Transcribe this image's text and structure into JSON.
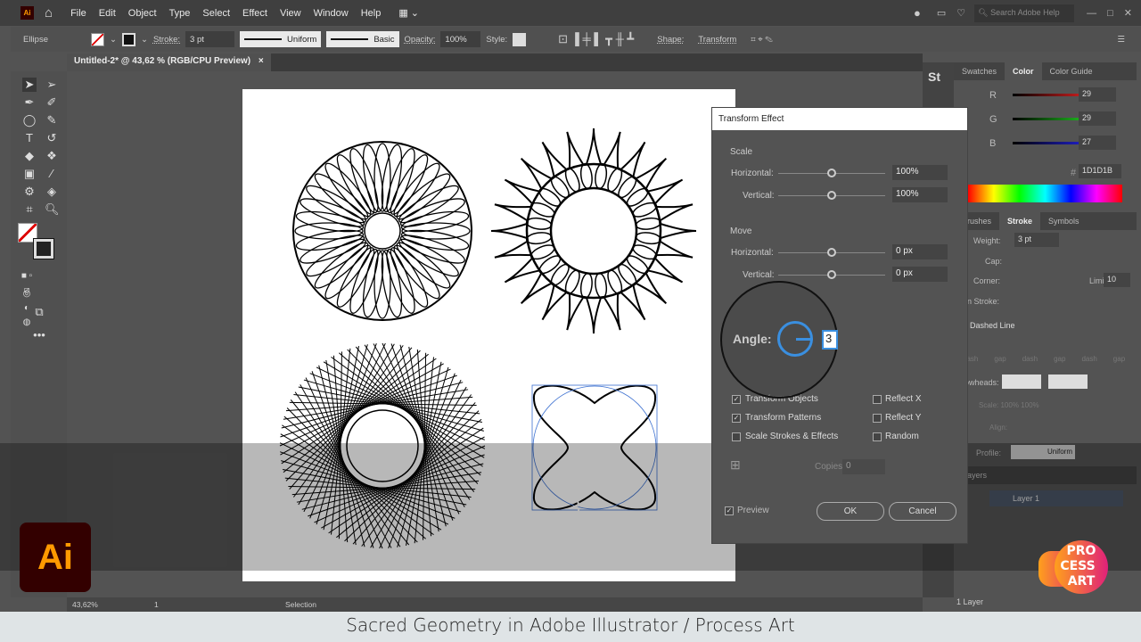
{
  "app": {
    "logo": "Ai",
    "menu": [
      "File",
      "Edit",
      "Object",
      "Type",
      "Select",
      "Effect",
      "View",
      "Window",
      "Help"
    ],
    "search_placeholder": "Search Adobe Help"
  },
  "control": {
    "object": "Ellipse",
    "stroke_label": "Stroke:",
    "stroke_value": "3 pt",
    "profile": "Uniform",
    "brush": "Basic",
    "opacity_label": "Opacity:",
    "opacity_value": "100%",
    "style_label": "Style:",
    "shape_label": "Shape:",
    "transform_label": "Transform"
  },
  "document": {
    "tab": "Untitled-2* @ 43,62 % (RGB/CPU Preview)",
    "close": "×"
  },
  "artwork": {
    "selection_number": "3"
  },
  "dialog": {
    "title": "Transform Effect",
    "scale": {
      "label": "Scale",
      "h_label": "Horizontal:",
      "h_value": "100%",
      "v_label": "Vertical:",
      "v_value": "100%"
    },
    "move": {
      "label": "Move",
      "h_label": "Horizontal:",
      "h_value": "0 px",
      "v_label": "Vertical:",
      "v_value": "0 px"
    },
    "angle": {
      "label": "Angle:",
      "value": "3"
    },
    "options": [
      {
        "label": "Transform Objects",
        "checked": true
      },
      {
        "label": "Transform Patterns",
        "checked": true
      },
      {
        "label": "Scale Strokes & Effects",
        "checked": false
      },
      {
        "label": "Reflect X",
        "checked": false
      },
      {
        "label": "Reflect Y",
        "checked": false
      },
      {
        "label": "Random",
        "checked": false
      }
    ],
    "copies_label": "Copies",
    "copies_value": "0",
    "preview_label": "Preview",
    "ok": "OK",
    "cancel": "Cancel"
  },
  "color_panel": {
    "tabs": [
      "Swatches",
      "Color",
      "Color Guide"
    ],
    "r": "29",
    "g": "29",
    "b": "27",
    "hex_label": "#",
    "hex": "1D1D1B",
    "accent_r": "#d42020",
    "accent_g": "#20c020",
    "accent_b": "#2020d0"
  },
  "stroke_panel": {
    "tabs": [
      "Brushes",
      "Stroke",
      "Symbols"
    ],
    "weight_label": "Weight:",
    "weight": "3 pt",
    "cap_label": "Cap:",
    "corner_label": "Corner:",
    "limit_label": "Limit:",
    "limit": "10",
    "align_label": "Align Stroke:",
    "dashed_label": "Dashed Line",
    "dash_labels": [
      "dash",
      "gap",
      "dash",
      "gap",
      "dash",
      "gap"
    ],
    "arrowheads_label": "Arrowheads:",
    "scale_label": "Scale:",
    "scale1": "100%",
    "scale2": "100%",
    "align2_label": "Align:",
    "profile_label": "Profile:",
    "profile": "Uniform"
  },
  "layers_panel": {
    "tab": "Layers",
    "layer": "Layer 1",
    "count": "1 Layer"
  },
  "status": {
    "zoom": "43,62%",
    "artboard": "1",
    "tool": "Selection"
  },
  "caption": "Sacred Geometry in Adobe Illustrator /  Process Art",
  "watermark": {
    "left": "Ai",
    "right": "PRO CESS ART"
  }
}
